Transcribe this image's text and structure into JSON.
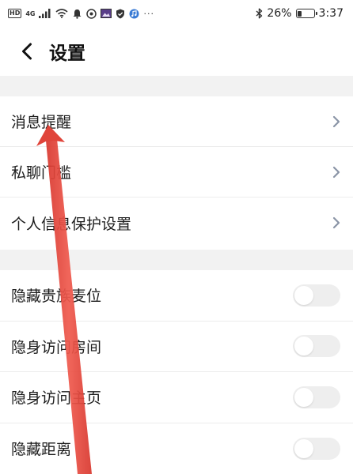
{
  "status_bar": {
    "badge": "HD",
    "network": "4G",
    "battery_percent": "26%",
    "battery_level": 0.26,
    "time": "3:37",
    "more": "···",
    "icons": [
      "signal-icon",
      "wifi-icon",
      "notification-bell-icon",
      "app-icon",
      "image-icon",
      "shield-icon",
      "music-icon",
      "bluetooth-icon",
      "battery-icon"
    ]
  },
  "header": {
    "title": "设置",
    "back_icon": "chevron-left-icon"
  },
  "nav_items": [
    {
      "label": "消息提醒"
    },
    {
      "label": "私聊门槛"
    },
    {
      "label": "个人信息保护设置"
    }
  ],
  "toggle_items": [
    {
      "label": "隐藏贵族麦位",
      "on": false
    },
    {
      "label": "隐身访问房间",
      "on": false
    },
    {
      "label": "隐身访问主页",
      "on": false
    },
    {
      "label": "隐藏距离",
      "on": false
    }
  ],
  "colors": {
    "annotation_arrow": "#e8473c",
    "section_gap": "#f2f2f2",
    "toggle_off": "#eeeeee",
    "chevron": "#8a94a6"
  }
}
